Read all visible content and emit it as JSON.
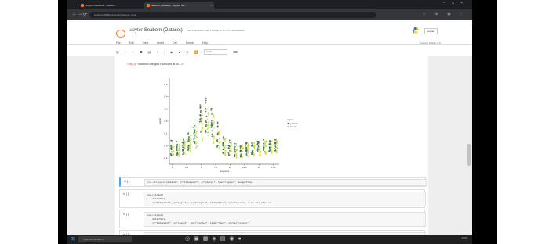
{
  "browser": {
    "tabs": [
      {
        "label": "Jupyter Notebook — lesson …",
        "active": false
      },
      {
        "label": "Seaborn (Dataset) - Jupyter No…",
        "active": true
      }
    ],
    "url": "localhost:8888/notebooks/Seaborn.ipynb"
  },
  "jupyter": {
    "logo_text": "jupyter",
    "notebook_name": "Seaborn (Dataset)",
    "checkpoint": "Last Checkpoint: Last Tuesday at 7:17 PM (autosaved)",
    "logout_label": "Logout",
    "menu": [
      "File",
      "Edit",
      "View",
      "Insert",
      "Cell",
      "Kernel",
      "Help"
    ],
    "kernel_info": "Trusted  |  Python 3 O",
    "toolbar_select": "Code"
  },
  "output_prompt": "Out[11]:",
  "output_text": "<seaborn.axisgrid.FacetGrid at 0x…>",
  "cells": [
    {
      "prompt": "In [ ]:",
      "code": "sns.stripplot(data=df, x=\"timepoint\", y=\"signal\", hue=\"region\", dodge=True)"
    },
    {
      "prompt": "In [ ]:",
      "code": "sns.relplot(\n    data=fmri,\n    x=\"timepoint\", y=\"signal\", hue=\"region\", kind=\"line\", col=\"event\")  # we can also use\n"
    },
    {
      "prompt": "In [ ]:",
      "code": "sns.relplot(\n    data=fmri,\n    x=\"timepoint\", y=\"signal\", hue=\"region\", kind=\"line\", style=\"region\")"
    },
    {
      "prompt": "In [ ]:",
      "code": "sns.relplot("
    }
  ],
  "chart_data": {
    "type": "scatter",
    "xlabel": "timepoint",
    "ylabel": "signal",
    "x_ticks": [
      0,
      2.5,
      5,
      7.5,
      10,
      12.5,
      15,
      17.5
    ],
    "y_ticks": [
      -0.1,
      0.0,
      0.1,
      0.2,
      0.3,
      0.4,
      0.5
    ],
    "xlim": [
      -0.5,
      18.5
    ],
    "ylim": [
      -0.15,
      0.55
    ],
    "legend": {
      "title": "region",
      "entries": [
        "parietal",
        "frontal"
      ],
      "placement": "right"
    },
    "series": [
      {
        "name": "parietal",
        "color": "#2b7a3a",
        "x": [
          0,
          1,
          2,
          3,
          4,
          5,
          6,
          7,
          8,
          9,
          10,
          11,
          12,
          13,
          14,
          15,
          16,
          17,
          18
        ],
        "y_min": [
          -0.09,
          -0.08,
          -0.07,
          -0.04,
          0.02,
          0.08,
          0.1,
          0.06,
          -0.03,
          -0.07,
          -0.08,
          -0.09,
          -0.09,
          -0.08,
          -0.07,
          -0.06,
          -0.05,
          -0.05,
          -0.05
        ],
        "y_max": [
          0.05,
          0.04,
          0.06,
          0.12,
          0.22,
          0.34,
          0.4,
          0.33,
          0.2,
          0.09,
          0.05,
          0.03,
          0.02,
          0.03,
          0.04,
          0.04,
          0.05,
          0.05,
          0.05
        ]
      },
      {
        "name": "frontal",
        "color": "#d8d33a",
        "x": [
          0,
          1,
          2,
          3,
          4,
          5,
          6,
          7,
          8,
          9,
          10,
          11,
          12,
          13,
          14,
          15,
          16,
          17,
          18
        ],
        "y_min": [
          -0.1,
          -0.09,
          -0.08,
          -0.06,
          -0.02,
          0.03,
          0.05,
          0.02,
          -0.04,
          -0.08,
          -0.09,
          -0.1,
          -0.1,
          -0.1,
          -0.09,
          -0.08,
          -0.07,
          -0.06,
          -0.06
        ],
        "y_max": [
          0.04,
          0.03,
          0.05,
          0.09,
          0.17,
          0.26,
          0.3,
          0.25,
          0.14,
          0.06,
          0.03,
          0.02,
          0.01,
          0.02,
          0.03,
          0.03,
          0.04,
          0.04,
          0.04
        ]
      }
    ]
  },
  "taskbar": {
    "search_placeholder": "Type here to search",
    "time": "12:01",
    "date": "…"
  },
  "colors": {
    "accent": "#f37726",
    "selected_cell": "#42a5f5",
    "prompt": "#303f9f"
  }
}
